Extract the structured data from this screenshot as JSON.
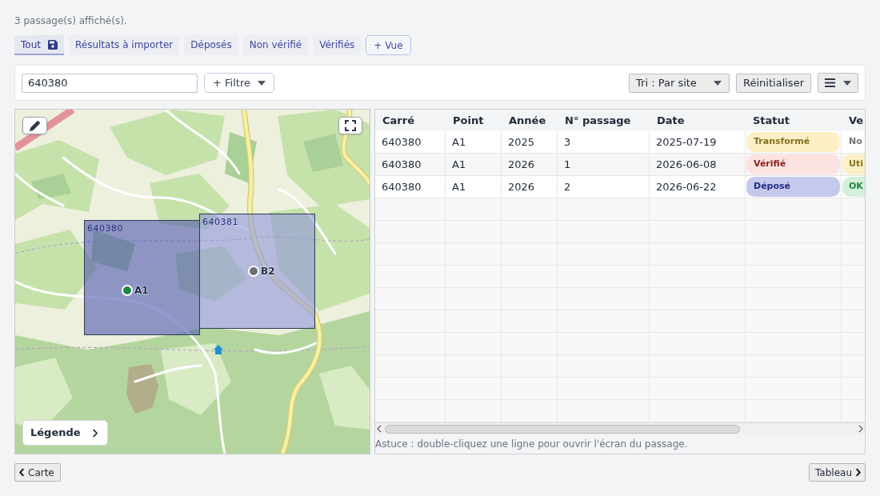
{
  "summary": "3 passage(s) affiché(s).",
  "tabs": [
    {
      "label": "Tout",
      "selected": true
    },
    {
      "label": "Résultats à importer",
      "selected": false
    },
    {
      "label": "Déposés",
      "selected": false
    },
    {
      "label": "Non vérifié",
      "selected": false
    },
    {
      "label": "Vérifiés",
      "selected": false
    }
  ],
  "add_view_button": "+ Vue",
  "toolbar": {
    "search": {
      "value": "640380"
    },
    "filter_button": "+ Filtre",
    "sort_dropdown": "Tri : Par site",
    "reset_button": "Réinitialiser"
  },
  "map": {
    "squares": [
      {
        "label": "640380",
        "selected": true
      },
      {
        "label": "640381",
        "selected": false
      }
    ],
    "points": [
      {
        "label": "A1",
        "color": "#1e8449"
      },
      {
        "label": "B2",
        "color": "#6b7075"
      }
    ],
    "legend_button": "Légende"
  },
  "table": {
    "columns": [
      "Carré",
      "Point",
      "Année",
      "N° passage",
      "Date",
      "Statut",
      "Ve"
    ],
    "rows": [
      {
        "cells": [
          "640380",
          "A1",
          "2025",
          "3",
          "2025-07-19"
        ],
        "status": {
          "label": "Transformé",
          "color": "#fdf0c6"
        },
        "column_7": {
          "label": "No",
          "color": "#ffffff"
        }
      },
      {
        "cells": [
          "640380",
          "A1",
          "2026",
          "1",
          "2026-06-08"
        ],
        "status": {
          "label": "Vérifié",
          "color": "#fde2e2"
        },
        "column_7": {
          "label": "Uti",
          "color": "#fdf0c6"
        }
      },
      {
        "cells": [
          "640380",
          "A1",
          "2026",
          "2",
          "2026-06-22"
        ],
        "status": {
          "label": "Déposé",
          "color": "#c5c9eb"
        },
        "column_7": {
          "label": "OK",
          "color": "#d4efdb"
        }
      }
    ]
  },
  "hint": "Astuce : double-cliquez une ligne pour ouvrir l'écran du passage.",
  "nav": {
    "previous": "Carte",
    "next": "Tableau"
  }
}
